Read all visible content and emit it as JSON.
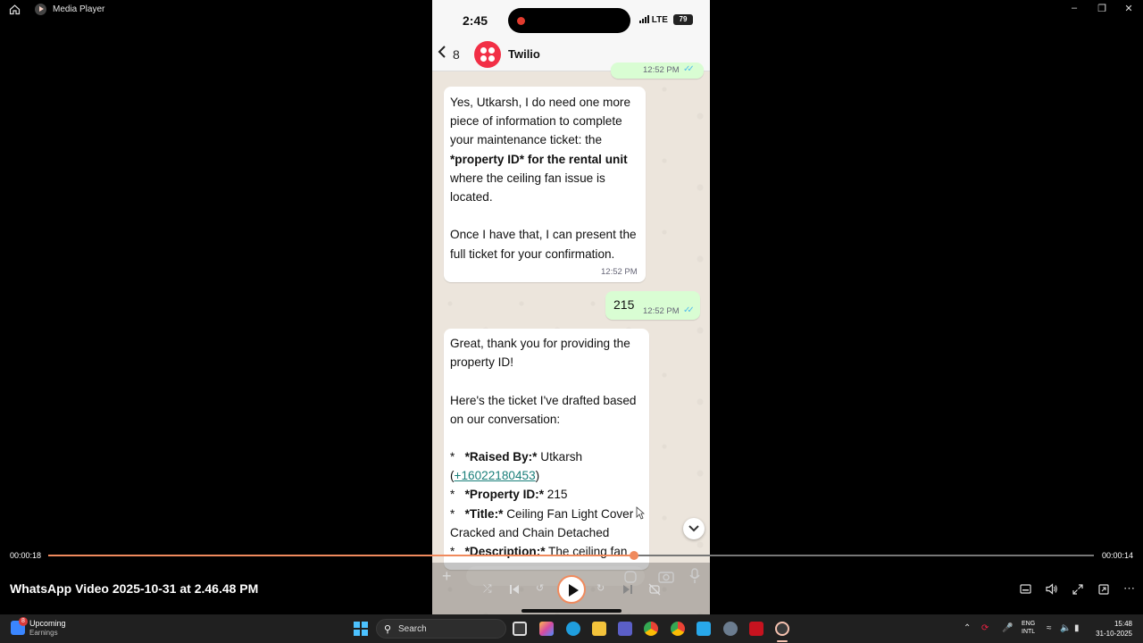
{
  "window": {
    "title": "Media Player"
  },
  "phone": {
    "status": {
      "time": "2:45",
      "network": "LTE",
      "battery": "79"
    },
    "chat": {
      "back_count": "8",
      "contact_name": "Twilio",
      "partial_timestamp": "12:52 PM",
      "messages": [
        {
          "direction": "incoming",
          "lines": [
            "Yes, Utkarsh, I do need one more",
            "piece of information to complete",
            "your maintenance ticket: the",
            "*property ID* for the rental unit",
            "where the ceiling fan issue is",
            "located.",
            "",
            "Once I have that, I can present the",
            "full ticket for your confirmation."
          ],
          "time": "12:52 PM"
        },
        {
          "direction": "outgoing",
          "text": "215",
          "time": "12:52 PM"
        },
        {
          "direction": "incoming",
          "intro": [
            "Great, thank you for providing the",
            "property ID!",
            "",
            "Here's the ticket I've drafted based",
            "on our conversation:"
          ],
          "ticket": {
            "raised_by_label": "*Raised By:*",
            "raised_by_value": "Utkarsh",
            "phone": "+16022180453",
            "property_label": "*Property ID:*",
            "property_value": "215",
            "title_label": "*Title:*",
            "title_value_1": "Ceiling Fan Light Cover",
            "title_value_2": "Cracked and Chain Detached",
            "description_label": "*Description:*",
            "description_value": "The ceiling fan"
          }
        }
      ]
    }
  },
  "player": {
    "current_time": "00:00:18",
    "duration": "00:00:14",
    "progress": 0.56,
    "video_title": "WhatsApp Video 2025-10-31 at 2.46.48 PM"
  },
  "taskbar": {
    "weather_badge": "8",
    "weather_line1": "Upcoming",
    "weather_line2": "Earnings",
    "search_placeholder": "Search",
    "lang_line1": "ENG",
    "lang_line2": "INTL",
    "clock_time": "15:48",
    "clock_date": "31-10-2025"
  },
  "colors": {
    "accent": "#f08a5d",
    "incoming_bubble": "#ffffff",
    "outgoing_bubble": "#d9fdd3",
    "twilio_red": "#f22f46"
  }
}
